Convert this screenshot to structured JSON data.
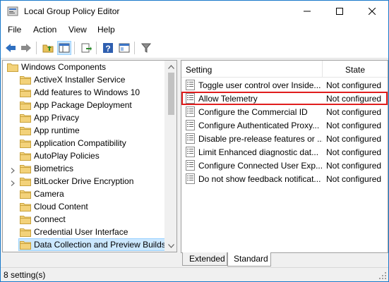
{
  "window": {
    "title": "Local Group Policy Editor"
  },
  "menu": [
    "File",
    "Action",
    "View",
    "Help"
  ],
  "toolbar": {
    "buttons": [
      "back-icon",
      "forward-icon",
      "up-folder-icon",
      "show-hide-tree-icon",
      "export-list-icon",
      "help-icon",
      "extended-view-icon",
      "filter-icon"
    ]
  },
  "tree": {
    "items": [
      {
        "label": "Windows Components",
        "expanded": true
      },
      {
        "label": "ActiveX Installer Service"
      },
      {
        "label": "Add features to Windows 10"
      },
      {
        "label": "App Package Deployment"
      },
      {
        "label": "App Privacy"
      },
      {
        "label": "App runtime"
      },
      {
        "label": "Application Compatibility"
      },
      {
        "label": "AutoPlay Policies"
      },
      {
        "label": "Biometrics",
        "has_children": true
      },
      {
        "label": "BitLocker Drive Encryption",
        "has_children": true
      },
      {
        "label": "Camera"
      },
      {
        "label": "Cloud Content"
      },
      {
        "label": "Connect"
      },
      {
        "label": "Credential User Interface"
      },
      {
        "label": "Data Collection and Preview Builds",
        "selected": true
      }
    ]
  },
  "list": {
    "columns": {
      "setting": "Setting",
      "state": "State"
    },
    "rows": [
      {
        "name": "Toggle user control over Inside...",
        "state": "Not configured"
      },
      {
        "name": "Allow Telemetry",
        "state": "Not configured",
        "highlighted": true
      },
      {
        "name": "Configure the Commercial ID",
        "state": "Not configured"
      },
      {
        "name": "Configure Authenticated Proxy...",
        "state": "Not configured"
      },
      {
        "name": "Disable pre-release features or ...",
        "state": "Not configured"
      },
      {
        "name": "Limit Enhanced diagnostic dat...",
        "state": "Not configured"
      },
      {
        "name": "Configure Connected User Exp...",
        "state": "Not configured"
      },
      {
        "name": "Do not show feedback notificat...",
        "state": "Not configured"
      }
    ]
  },
  "tabs": [
    "Extended",
    "Standard"
  ],
  "active_tab": "Standard",
  "status": {
    "text": "8 setting(s)"
  },
  "colors": {
    "selection": "#cce8ff",
    "highlight_border": "#e01d1d",
    "window_border": "#1979ca"
  }
}
